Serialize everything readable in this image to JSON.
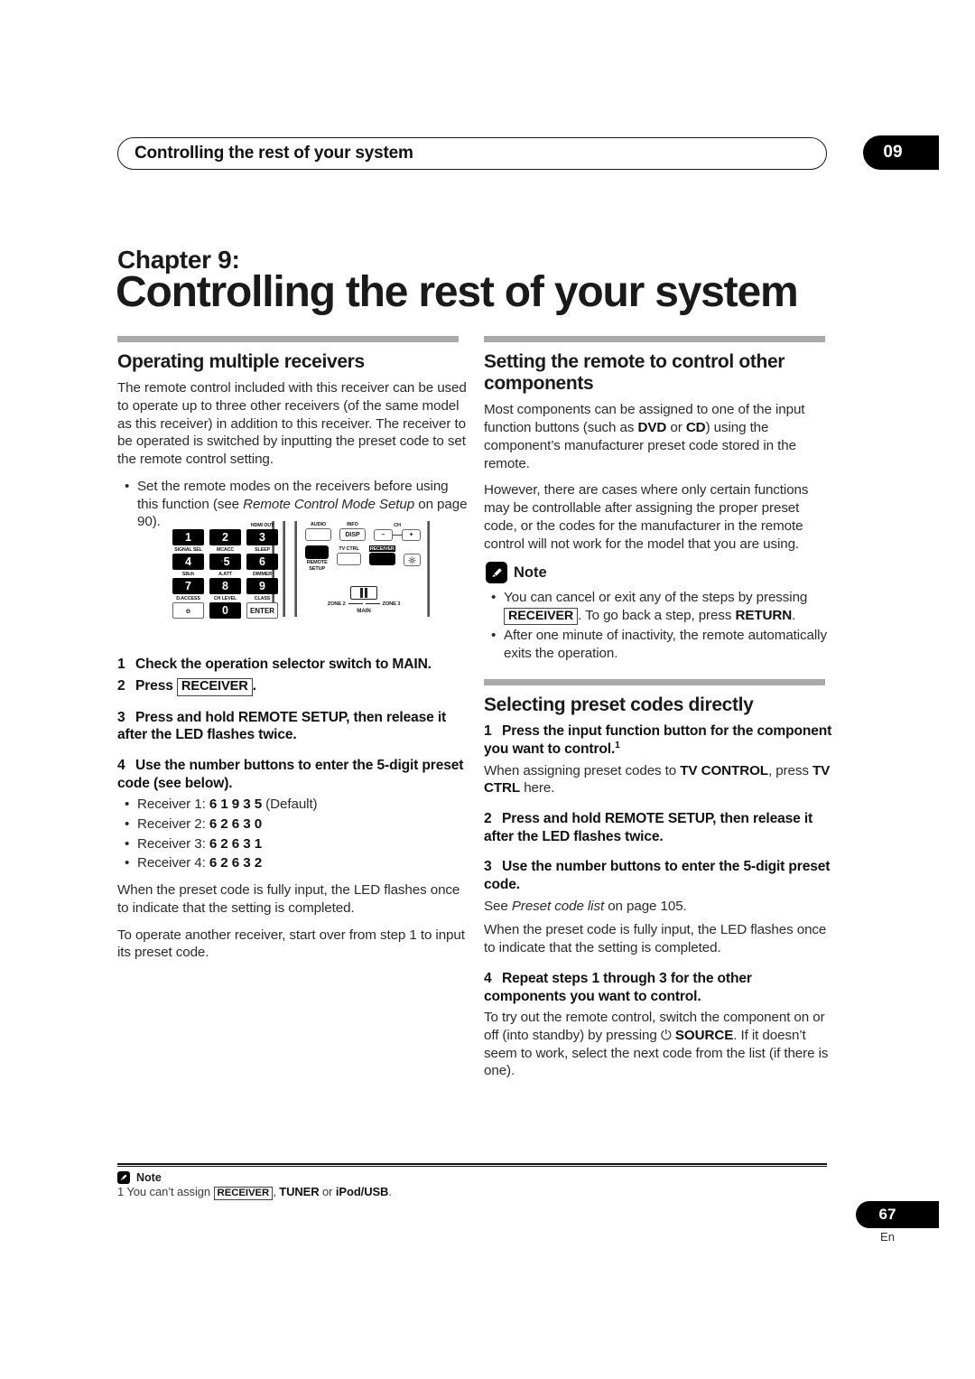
{
  "header": {
    "running_title": "Controlling the rest of your system",
    "chapter_tab": "09"
  },
  "chapter": {
    "label": "Chapter 9:",
    "title": "Controlling the rest of your system"
  },
  "left_column": {
    "section_title": "Operating multiple receivers",
    "intro": "The remote control included with this receiver can be used to operate up to three other receivers (of the same model as this receiver) in addition to this receiver. The receiver to be operated is switched by inputting the preset code to set the remote control setting.",
    "bullet_1_pre": "Set the remote modes on the receivers before using this function (see ",
    "bullet_1_italic": "Remote Control Mode Setup",
    "bullet_1_post": " on page 90).",
    "steps": [
      {
        "num": "1",
        "text": "Check the operation selector switch to MAIN."
      },
      {
        "num": "2",
        "text_pre": "Press ",
        "chip": "RECEIVER",
        "text_post": "."
      },
      {
        "num": "3",
        "text": "Press and hold REMOTE SETUP, then release it after the LED flashes twice."
      },
      {
        "num": "4",
        "text": "Use the number buttons to enter the 5-digit preset code (see below)."
      }
    ],
    "receiver_codes": [
      {
        "label": "Receiver 1: ",
        "code": "6 1 9 3 5",
        "suffix": " (Default)"
      },
      {
        "label": "Receiver 2: ",
        "code": "6 2 6 3 0",
        "suffix": ""
      },
      {
        "label": "Receiver 3: ",
        "code": "6 2 6 3 1",
        "suffix": ""
      },
      {
        "label": "Receiver 4: ",
        "code": "6 2 6 3 2",
        "suffix": ""
      }
    ],
    "after_code": "When the preset code is fully input, the LED flashes once to indicate that the setting is completed.",
    "another_receiver": "To operate another receiver, start over from step 1 to input its preset code."
  },
  "remote_diagram": {
    "keypad": [
      {
        "label": "",
        "key": "1"
      },
      {
        "label": "",
        "key": "2"
      },
      {
        "label": "HDMI OUT",
        "key": "3"
      },
      {
        "label": "SIGNAL SEL",
        "key": "4"
      },
      {
        "label": "MCACC",
        "key": "5",
        "dot": true
      },
      {
        "label": "SLEEP",
        "key": "6"
      },
      {
        "label": "SBch",
        "key": "7"
      },
      {
        "label": "A.ATT",
        "key": "8"
      },
      {
        "label": "DIMMER",
        "key": "9"
      },
      {
        "label": "D.ACCESS",
        "key": "o",
        "outline": true
      },
      {
        "label": "CH LEVEL",
        "key": "0"
      },
      {
        "label": "CLASS",
        "key": "ENTER",
        "outline": true
      }
    ],
    "right_panel": {
      "audio_label": "AUDIO",
      "info_label": "INFO",
      "disp_key": "DISP",
      "ch_label": "CH",
      "ch_minus": "–",
      "ch_plus": "+",
      "remote_setup_label": "REMOTE\nSETUP",
      "tv_ctrl_label": "TV CTRL",
      "receiver_chip": "RECEIVER",
      "light_icon": "light-bulb-icon"
    },
    "zone_switch": {
      "left": "ZONE 2",
      "right": "ZONE 3",
      "center": "MAIN"
    }
  },
  "right_column": {
    "section_title": "Setting the remote to control other components",
    "para_1_a": "Most components can be assigned to one of the input function buttons (such as ",
    "para_1_dvd": "DVD",
    "para_1_b": " or ",
    "para_1_cd": "CD",
    "para_1_c": ") using the component’s manufacturer preset code stored in the remote.",
    "para_2": "However, there are cases where only certain functions may be controllable after assigning the proper preset code, or the codes for the manufacturer in the remote control will not work for the model that you are using.",
    "note_label": "Note",
    "note_icon": "pencil-icon",
    "note_bullet_1_a": "You can cancel or exit any of the steps by pressing ",
    "note_bullet_1_chip": "RECEIVER",
    "note_bullet_1_b": ". To go back a step, press ",
    "note_bullet_1_bold": "RETURN",
    "note_bullet_1_c": ".",
    "note_bullet_2": "After one minute of inactivity, the remote automatically exits the operation.",
    "section_title_2": "Selecting preset codes directly",
    "step_1": "Press the input function button for the component you want to control.",
    "step_1_sup": "1",
    "step_1_note_a": "When assigning preset codes to ",
    "step_1_note_bold": "TV CONTROL",
    "step_1_note_b": ", press ",
    "step_1_note_bold2": "TV CTRL",
    "step_1_note_c": " here.",
    "step_2": "Press and hold REMOTE SETUP, then release it after the LED flashes twice.",
    "step_3": "Use the number buttons to enter the 5-digit preset code.",
    "step_3_note_a": "See ",
    "step_3_note_italic": "Preset code list",
    "step_3_note_b": " on page 105.",
    "step_3_note_2": "When the preset code is fully input, the LED flashes once to indicate that the setting is completed.",
    "step_4": "Repeat steps 1 through 3 for the other components you want to control.",
    "step_4_note_a": "To try out the remote control, switch the component on or off (into standby) by pressing ",
    "step_4_note_icon": "power-icon",
    "step_4_note_bold": "SOURCE",
    "step_4_note_b": ". If it doesn’t seem to work, select the next code from the list (if there is one)."
  },
  "footnote": {
    "note_label": "Note",
    "note_icon": "pencil-icon",
    "text_a": "1 You can’t assign ",
    "chip": "RECEIVER",
    "text_b": ", ",
    "bold_1": "TUNER",
    "text_c": " or ",
    "bold_2": "iPod/USB",
    "text_d": "."
  },
  "page": {
    "number": "67",
    "language": "En"
  }
}
